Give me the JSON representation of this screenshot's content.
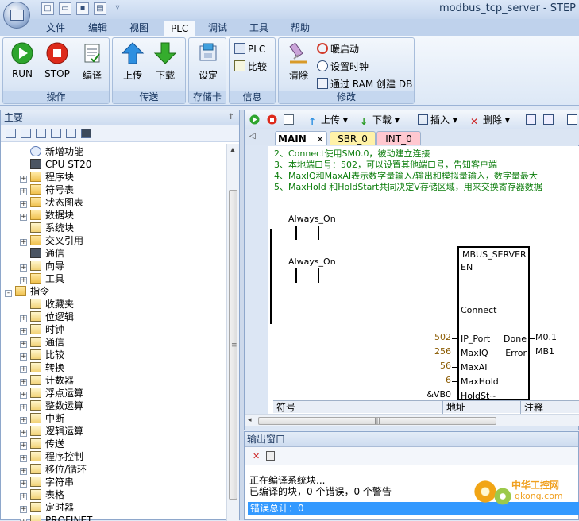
{
  "window": {
    "title": "modbus_tcp_server - STEP"
  },
  "quick_access": {
    "icons": [
      "new-icon",
      "open-icon",
      "save-icon",
      "print-icon",
      "customize-arrow-icon"
    ]
  },
  "ribbon_tabs": [
    "文件",
    "编辑",
    "视图",
    "PLC",
    "调试",
    "工具",
    "帮助"
  ],
  "ribbon": {
    "group_operation": {
      "name": "操作",
      "run": "RUN",
      "stop": "STOP",
      "compile": "编译"
    },
    "group_transfer": {
      "name": "传送",
      "upload": "上传",
      "download": "下载"
    },
    "group_memcard": {
      "name": "存储卡",
      "setup": "设定"
    },
    "group_info": {
      "name": "信息",
      "plc": "PLC",
      "compare": "比较"
    },
    "group_modify": {
      "name": "修改",
      "clear": "清除",
      "warm_start": "暖启动",
      "set_clock": "设置时钟",
      "create_db": "通过 RAM 创建 DB"
    }
  },
  "left_panel": {
    "title": "主要",
    "pin": "↑",
    "tree": [
      {
        "label": "新增功能",
        "icon": "help-icon",
        "expander": ""
      },
      {
        "label": "CPU ST20",
        "icon": "cpu-icon",
        "expander": ""
      },
      {
        "label": "程序块",
        "icon": "folder-icon",
        "expander": "+"
      },
      {
        "label": "符号表",
        "icon": "folder-icon",
        "expander": "+"
      },
      {
        "label": "状态图表",
        "icon": "folder-icon",
        "expander": "+"
      },
      {
        "label": "数据块",
        "icon": "folder-icon",
        "expander": "+"
      },
      {
        "label": "系统块",
        "icon": "block-icon",
        "expander": ""
      },
      {
        "label": "交叉引用",
        "icon": "folder-icon",
        "expander": "+"
      },
      {
        "label": "通信",
        "icon": "comm-icon",
        "expander": ""
      },
      {
        "label": "向导",
        "icon": "wizard-icon",
        "expander": "+"
      },
      {
        "label": "工具",
        "icon": "folder-icon",
        "expander": "+"
      },
      {
        "label": "指令",
        "icon": "folder-icon",
        "expander": "-"
      },
      {
        "label": "收藏夹",
        "icon": "favorites-icon",
        "expander": ""
      },
      {
        "label": "位逻辑",
        "icon": "instr-icon",
        "expander": "+"
      },
      {
        "label": "时钟",
        "icon": "clock-icon",
        "expander": "+"
      },
      {
        "label": "通信",
        "icon": "instr-icon",
        "expander": "+"
      },
      {
        "label": "比较",
        "icon": "instr-icon",
        "expander": "+"
      },
      {
        "label": "转换",
        "icon": "instr-icon",
        "expander": "+"
      },
      {
        "label": "计数器",
        "icon": "instr-icon",
        "expander": "+"
      },
      {
        "label": "浮点运算",
        "icon": "instr-icon",
        "expander": "+"
      },
      {
        "label": "整数运算",
        "icon": "instr-icon",
        "expander": "+"
      },
      {
        "label": "中断",
        "icon": "instr-icon",
        "expander": "+"
      },
      {
        "label": "逻辑运算",
        "icon": "instr-icon",
        "expander": "+"
      },
      {
        "label": "传送",
        "icon": "instr-icon",
        "expander": "+"
      },
      {
        "label": "程序控制",
        "icon": "instr-icon",
        "expander": "+"
      },
      {
        "label": "移位/循环",
        "icon": "instr-icon",
        "expander": "+"
      },
      {
        "label": "字符串",
        "icon": "instr-icon",
        "expander": "+"
      },
      {
        "label": "表格",
        "icon": "instr-icon",
        "expander": "+"
      },
      {
        "label": "定时器",
        "icon": "instr-icon",
        "expander": "+"
      },
      {
        "label": "PROFINET",
        "icon": "instr-icon",
        "expander": "+"
      }
    ]
  },
  "editor_toolbar": {
    "upload": "上传",
    "download": "下载",
    "insert": "插入",
    "delete": "删除"
  },
  "editor_tabs": [
    {
      "label": "MAIN",
      "close": "×",
      "color": "#ffffff"
    },
    {
      "label": "SBR_0",
      "close": "",
      "color": "#fff2a8"
    },
    {
      "label": "INT_0",
      "close": "",
      "color": "#ffc8d0"
    }
  ],
  "comments": [
    "2、Connect使用SM0.0，被动建立连接",
    "3、本地端口号：502，可以设置其他端口号，告知客户端",
    "4、MaxIQ和MaxAI表示数字量输入/输出和模拟量输入，数字量最大",
    "5、MaxHold 和HoldStart共同决定V存储区域，用来交换寄存器数据"
  ],
  "ladder": {
    "contact1": "Always_On",
    "contact2": "Always_On",
    "block_name": "MBUS_SERVER",
    "pins_in": [
      "EN",
      "Connect",
      "IP_Port",
      "MaxIQ",
      "MaxAI",
      "MaxHold",
      "HoldSt~"
    ],
    "pin_values": [
      "502",
      "256",
      "56",
      "6",
      "&VB0"
    ],
    "pins_out": [
      "Done",
      "Error"
    ],
    "out_values": [
      "M0.1",
      "MB1"
    ]
  },
  "symbol_table": {
    "symbol": "符号",
    "address": "地址",
    "comment": "注释"
  },
  "output": {
    "title": "输出窗口",
    "line1": "正在编译系统块...",
    "line2": "已编译的块，0 个错误，0 个警告",
    "line3": "错误总计：0"
  },
  "watermark": {
    "cn": "中华工控网",
    "en": "gkong.com"
  }
}
